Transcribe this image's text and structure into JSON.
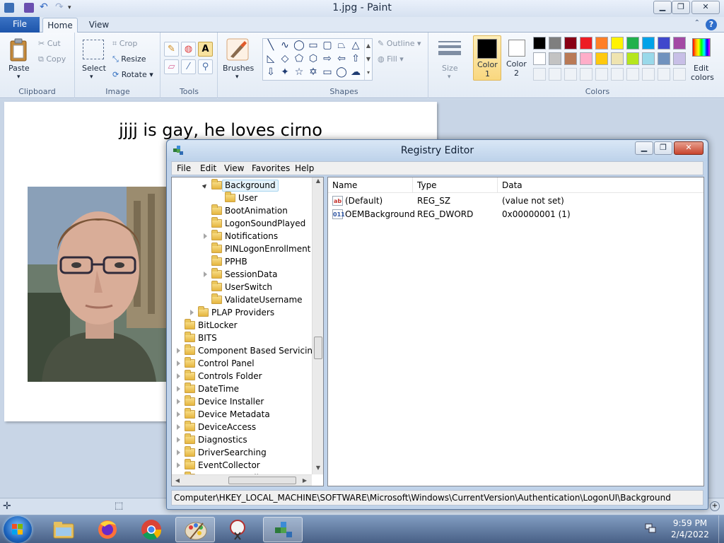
{
  "paint": {
    "title": "1.jpg - Paint",
    "tabs": {
      "file": "File",
      "home": "Home",
      "view": "View"
    },
    "clipboard": {
      "paste": "Paste",
      "cut": "Cut",
      "copy": "Copy",
      "label": "Clipboard"
    },
    "image": {
      "select": "Select",
      "crop": "Crop",
      "resize": "Resize",
      "rotate": "Rotate",
      "label": "Image"
    },
    "tools": {
      "label": "Tools",
      "brushes": "Brushes"
    },
    "shapes": {
      "outline": "Outline",
      "fill": "Fill",
      "label": "Shapes"
    },
    "size": {
      "label": "Size"
    },
    "colors": {
      "color1": "Color",
      "color1_num": "1",
      "color2": "Color",
      "color2_num": "2",
      "edit": "Edit",
      "edit2": "colors",
      "label": "Colors",
      "color1_value": "#000000",
      "color2_value": "#ffffff",
      "palette_row1": [
        "#000000",
        "#7f7f7f",
        "#880015",
        "#ed1c24",
        "#ff7f27",
        "#fff200",
        "#22b14c",
        "#00a2e8",
        "#3f48cc",
        "#a349a4"
      ],
      "palette_row2": [
        "#ffffff",
        "#c3c3c3",
        "#b97a57",
        "#ffaec9",
        "#ffc90e",
        "#efe4b0",
        "#b5e61d",
        "#99d9ea",
        "#7092be",
        "#c8bfe7"
      ]
    },
    "canvas_text": "jjjj is gay, he loves cirno"
  },
  "regedit": {
    "title": "Registry Editor",
    "menu": [
      "File",
      "Edit",
      "View",
      "Favorites",
      "Help"
    ],
    "tree": [
      {
        "label": "Background",
        "state": "open",
        "selected": true
      },
      {
        "label": "User",
        "state": "none"
      },
      {
        "label": "BootAnimation",
        "state": "none"
      },
      {
        "label": "LogonSoundPlayed",
        "state": "none"
      },
      {
        "label": "Notifications",
        "state": "closed"
      },
      {
        "label": "PINLogonEnrollment",
        "state": "none"
      },
      {
        "label": "PPHB",
        "state": "none"
      },
      {
        "label": "SessionData",
        "state": "closed"
      },
      {
        "label": "UserSwitch",
        "state": "none"
      },
      {
        "label": "ValidateUsername",
        "state": "none"
      },
      {
        "label": "PLAP Providers",
        "state": "closed"
      },
      {
        "label": "BitLocker",
        "state": "none"
      },
      {
        "label": "BITS",
        "state": "none"
      },
      {
        "label": "Component Based Servicing",
        "state": "closed"
      },
      {
        "label": "Control Panel",
        "state": "closed"
      },
      {
        "label": "Controls Folder",
        "state": "closed"
      },
      {
        "label": "DateTime",
        "state": "closed"
      },
      {
        "label": "Device Installer",
        "state": "closed"
      },
      {
        "label": "Device Metadata",
        "state": "closed"
      },
      {
        "label": "DeviceAccess",
        "state": "closed"
      },
      {
        "label": "Diagnostics",
        "state": "closed"
      },
      {
        "label": "DriverSearching",
        "state": "closed"
      },
      {
        "label": "EventCollector",
        "state": "closed"
      },
      {
        "label": "EventForwarding",
        "state": "closed"
      }
    ],
    "columns": {
      "name": "Name",
      "type": "Type",
      "data": "Data"
    },
    "values": [
      {
        "icon": "ab",
        "name": "(Default)",
        "type": "REG_SZ",
        "data": "(value not set)"
      },
      {
        "icon": "011",
        "name": "OEMBackground",
        "type": "REG_DWORD",
        "data": "0x00000001 (1)"
      }
    ],
    "status_path": "Computer\\HKEY_LOCAL_MACHINE\\SOFTWARE\\Microsoft\\Windows\\CurrentVersion\\Authentication\\LogonUI\\Background"
  },
  "taskbar": {
    "time": "9:59 PM",
    "date": "2/4/2022"
  }
}
